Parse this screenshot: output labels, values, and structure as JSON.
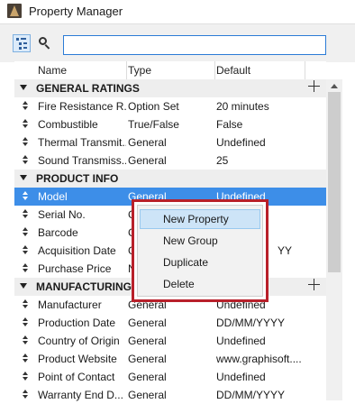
{
  "window": {
    "title": "Property Manager"
  },
  "search": {
    "value": "",
    "placeholder": ""
  },
  "columns": {
    "name": "Name",
    "type": "Type",
    "default": "Default"
  },
  "groups": [
    {
      "label": "GENERAL RATINGS",
      "rows": [
        {
          "name": "Fire Resistance R...",
          "type": "Option Set",
          "default": "20 minutes"
        },
        {
          "name": "Combustible",
          "type": "True/False",
          "default": "False"
        },
        {
          "name": "Thermal Transmit...",
          "type": "General",
          "default": "Undefined"
        },
        {
          "name": "Sound Transmiss...",
          "type": "General",
          "default": "25"
        }
      ]
    },
    {
      "label": "PRODUCT INFO",
      "rows": [
        {
          "name": "Model",
          "type": "General",
          "default": "Undefined"
        },
        {
          "name": "Serial No.",
          "type": "G",
          "default": ""
        },
        {
          "name": "Barcode",
          "type": "G",
          "default": ""
        },
        {
          "name": "Acquisition Date",
          "type": "G",
          "default": "YY"
        },
        {
          "name": "Purchase Price",
          "type": "N",
          "default": ""
        }
      ]
    },
    {
      "label": "MANUFACTURING",
      "rows": [
        {
          "name": "Manufacturer",
          "type": "General",
          "default": "Undefined"
        },
        {
          "name": "Production Date",
          "type": "General",
          "default": "DD/MM/YYYY"
        },
        {
          "name": "Country of Origin",
          "type": "General",
          "default": "Undefined"
        },
        {
          "name": "Product Website",
          "type": "General",
          "default": "www.graphisoft...."
        },
        {
          "name": "Point of Contact",
          "type": "General",
          "default": "Undefined"
        },
        {
          "name": "Warranty End D...",
          "type": "General",
          "default": "DD/MM/YYYY"
        }
      ]
    }
  ],
  "context_menu": {
    "items": [
      "New Property",
      "New Group",
      "Duplicate",
      "Delete"
    ]
  },
  "colors": {
    "selection": "#3d8ee8",
    "highlight_border": "#b8202a",
    "menu_hover": "#cde4f7"
  }
}
